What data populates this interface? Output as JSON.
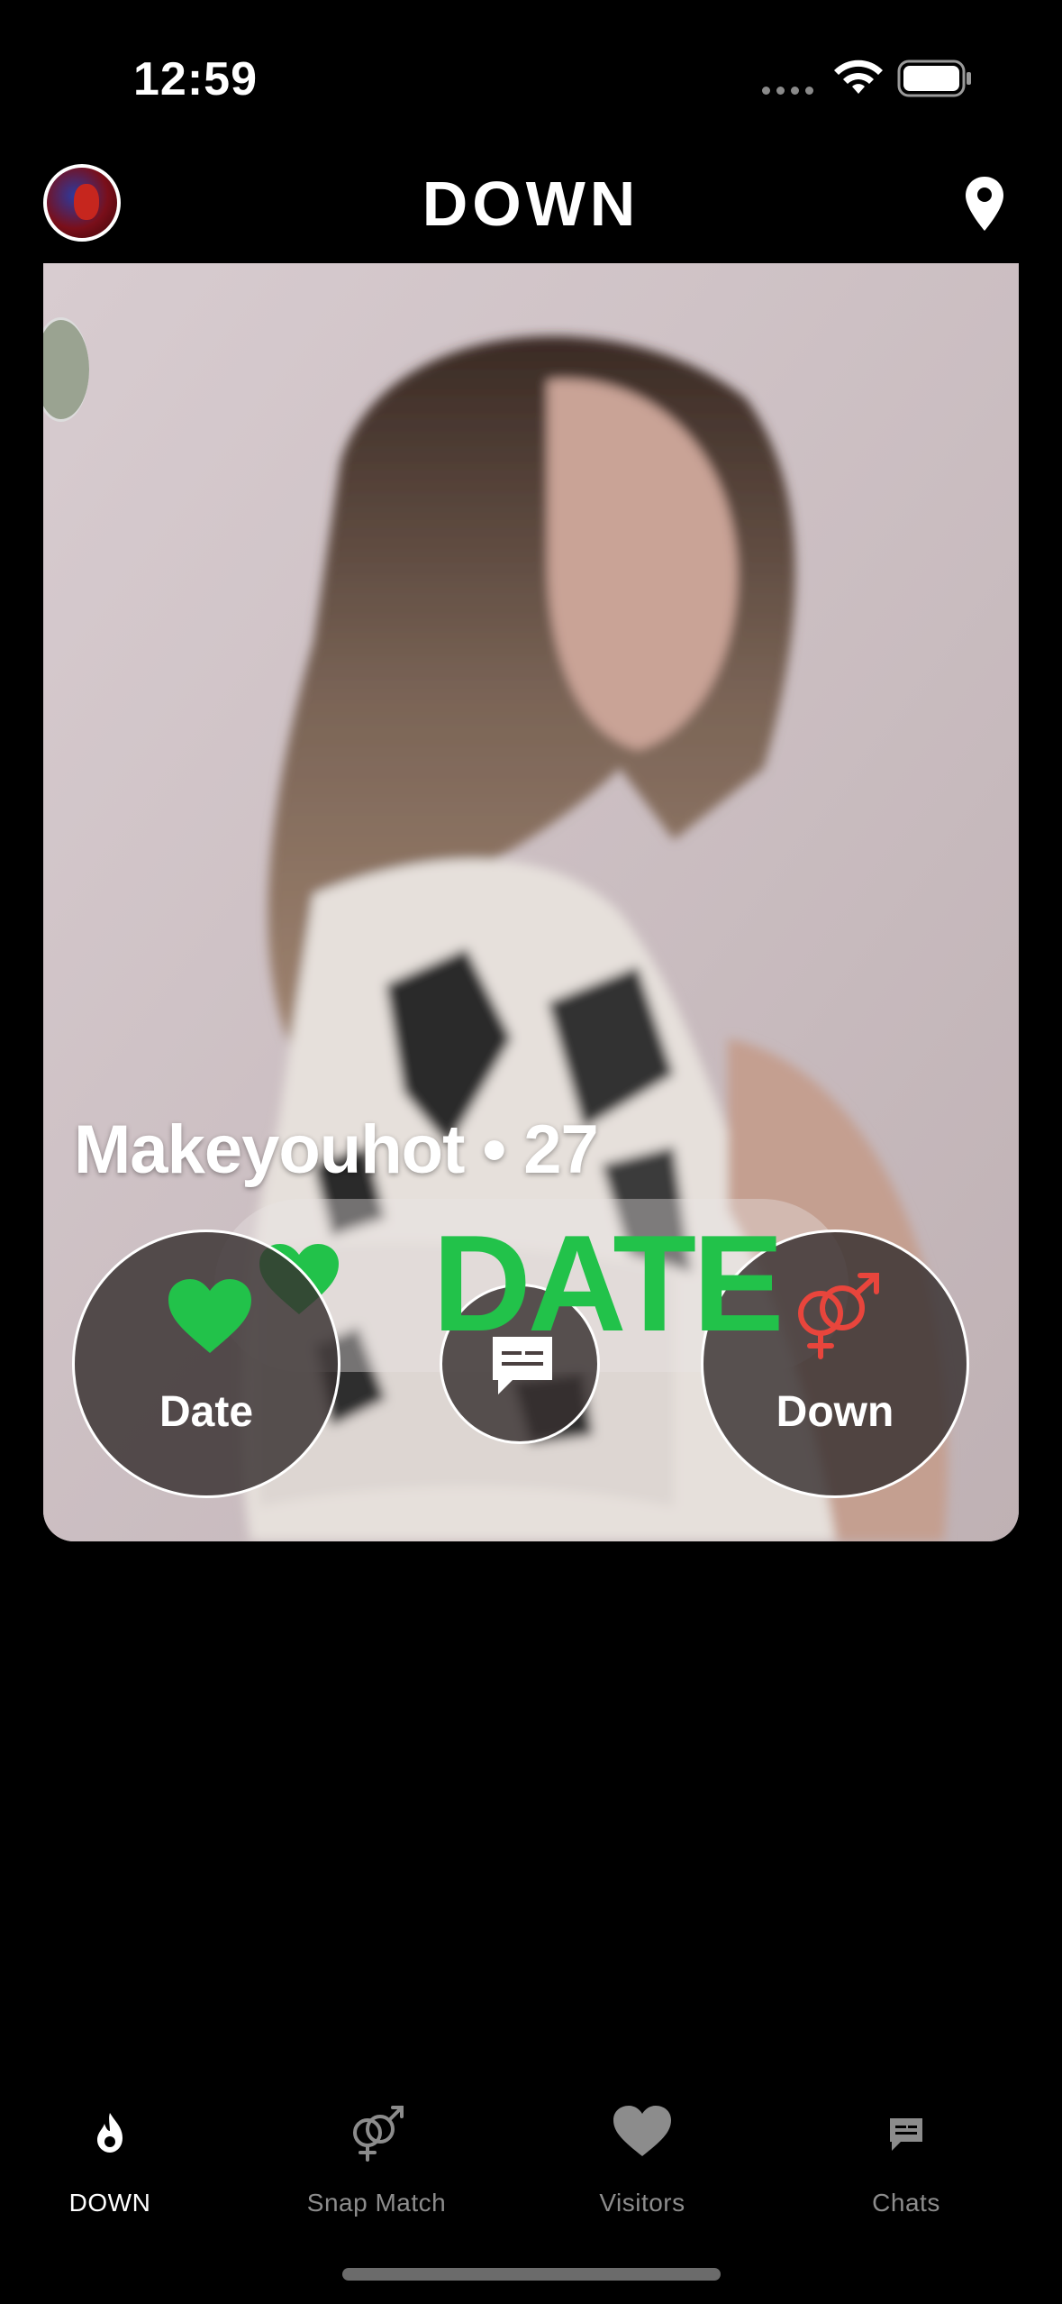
{
  "status_bar": {
    "time": "12:59"
  },
  "header": {
    "brand": "DOWN"
  },
  "profile": {
    "name_age": "Makeyouhot • 27"
  },
  "actions": {
    "date_label": "Date",
    "down_label": "Down"
  },
  "banner": {
    "stamp_text": "DATE"
  },
  "tabs": [
    {
      "label": "DOWN",
      "icon": "flame-icon",
      "active": true
    },
    {
      "label": "Snap Match",
      "icon": "gender-icon",
      "active": false
    },
    {
      "label": "Visitors",
      "icon": "heart-icon",
      "active": false
    },
    {
      "label": "Chats",
      "icon": "chat-icon",
      "active": false
    }
  ],
  "colors": {
    "accent_green": "#22c24a",
    "accent_red": "#e8453c",
    "background": "#000000"
  }
}
